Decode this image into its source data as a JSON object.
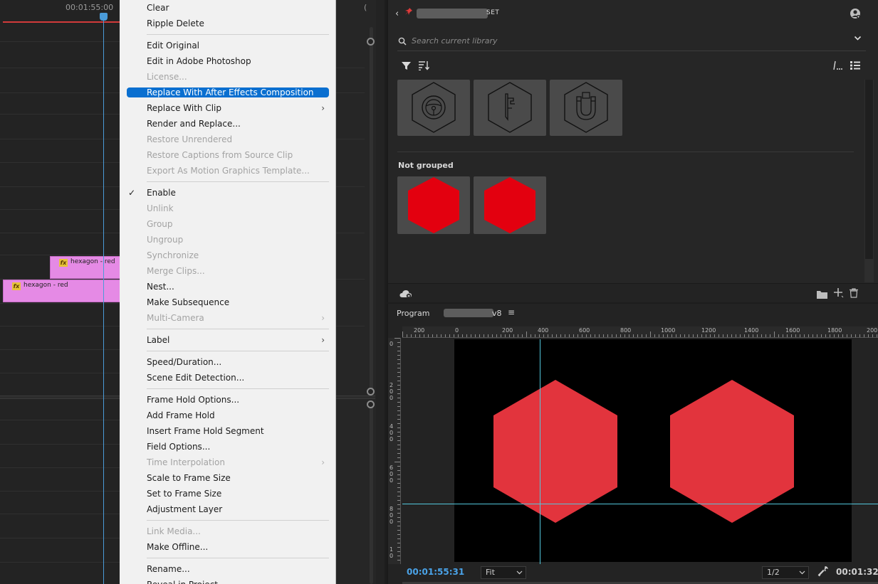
{
  "timeline": {
    "timecode": "00:01:55:00",
    "right_mark": "(",
    "clips": [
      {
        "name": "hexagon - red",
        "fx": "fx"
      },
      {
        "name": "hexagon - red",
        "fx": "fx"
      }
    ]
  },
  "context_menu": {
    "items": [
      {
        "label": "Clear",
        "enabled": true
      },
      {
        "label": "Ripple Delete",
        "enabled": true
      },
      {
        "label": "Edit Original",
        "enabled": true
      },
      {
        "label": "Edit in Adobe Photoshop",
        "enabled": true
      },
      {
        "label": "License...",
        "enabled": false
      },
      {
        "label": "Replace With After Effects Composition",
        "enabled": true,
        "selected": true
      },
      {
        "label": "Replace With Clip",
        "enabled": true,
        "submenu": true
      },
      {
        "label": "Render and Replace...",
        "enabled": true
      },
      {
        "label": "Restore Unrendered",
        "enabled": false
      },
      {
        "label": "Restore Captions from Source Clip",
        "enabled": false
      },
      {
        "label": "Export As Motion Graphics Template...",
        "enabled": false
      },
      {
        "label": "Enable",
        "enabled": true,
        "checked": true
      },
      {
        "label": "Unlink",
        "enabled": false
      },
      {
        "label": "Group",
        "enabled": false
      },
      {
        "label": "Ungroup",
        "enabled": false
      },
      {
        "label": "Synchronize",
        "enabled": false
      },
      {
        "label": "Merge Clips...",
        "enabled": false
      },
      {
        "label": "Nest...",
        "enabled": true
      },
      {
        "label": "Make Subsequence",
        "enabled": true
      },
      {
        "label": "Multi-Camera",
        "enabled": false,
        "submenu": true
      },
      {
        "label": "Label",
        "enabled": true,
        "submenu": true
      },
      {
        "label": "Speed/Duration...",
        "enabled": true
      },
      {
        "label": "Scene Edit Detection...",
        "enabled": true
      },
      {
        "label": "Frame Hold Options...",
        "enabled": true
      },
      {
        "label": "Add Frame Hold",
        "enabled": true
      },
      {
        "label": "Insert Frame Hold Segment",
        "enabled": true
      },
      {
        "label": "Field Options...",
        "enabled": true
      },
      {
        "label": "Time Interpolation",
        "enabled": false,
        "submenu": true
      },
      {
        "label": "Scale to Frame Size",
        "enabled": true
      },
      {
        "label": "Set to Frame Size",
        "enabled": true
      },
      {
        "label": "Adjustment Layer",
        "enabled": true
      },
      {
        "label": "Link Media...",
        "enabled": false
      },
      {
        "label": "Make Offline...",
        "enabled": true
      },
      {
        "label": "Rename...",
        "enabled": true
      },
      {
        "label": "Reveal in Project",
        "enabled": true
      }
    ],
    "check_glyph": "✓",
    "chevron_glyph": "›"
  },
  "library": {
    "title_suffix": "SET",
    "back_glyph": "‹",
    "pin_glyph": "📌",
    "search_placeholder": "Search current library",
    "dropdown_glyph": "⌄",
    "group_label": "Not grouped",
    "icon_tiles": [
      "steering-wheel-icon",
      "caliper-icon",
      "magnet-icon"
    ],
    "hex_tiles": [
      "hexagon-red",
      "hexagon-red"
    ],
    "hex_color": "#e3000f"
  },
  "program": {
    "title_prefix": "Program",
    "title_suffix": "v8",
    "menu_glyph": "≡",
    "ruler_h": [
      "200",
      "0",
      "200",
      "400",
      "600",
      "800",
      "1000",
      "1200",
      "1400",
      "1600",
      "1800",
      "200"
    ],
    "ruler_v": [
      "0",
      "200",
      "400",
      "600",
      "800",
      "10"
    ],
    "timecode_current": "00:01:55:31",
    "fit_label": "Fit",
    "resolution_label": "1/2",
    "timecode_duration": "00:01:32:",
    "hex_color": "#e2343d",
    "guide_color": "#52c7dc"
  }
}
